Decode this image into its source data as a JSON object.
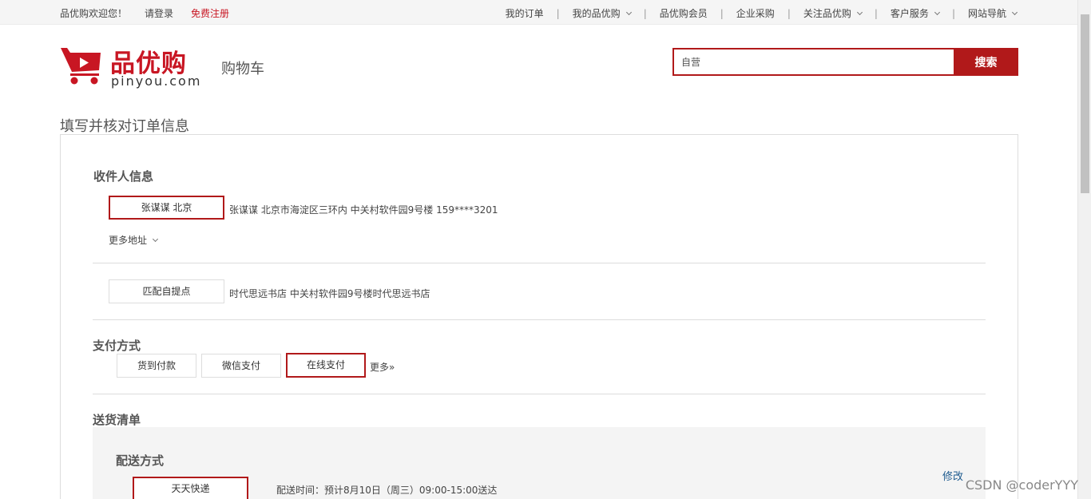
{
  "topbar": {
    "welcome": "品优购欢迎您！",
    "login": "请登录",
    "register": "免费注册",
    "nav": [
      {
        "label": "我的订单",
        "dropdown": false
      },
      {
        "label": "我的品优购",
        "dropdown": true
      },
      {
        "label": "品优购会员",
        "dropdown": false
      },
      {
        "label": "企业采购",
        "dropdown": false
      },
      {
        "label": "关注品优购",
        "dropdown": true
      },
      {
        "label": "客户服务",
        "dropdown": true
      },
      {
        "label": "网站导航",
        "dropdown": true
      }
    ]
  },
  "header": {
    "logo_cn": "品优购",
    "logo_en": "pinyou.com",
    "subtitle": "购物车",
    "search_value": "自营",
    "search_button": "搜索"
  },
  "page_title": "填写并核对订单信息",
  "receiver": {
    "title": "收件人信息",
    "selected": "张谋谋 北京",
    "detail": "张谋谋 北京市海淀区三环内 中关村软件园9号楼 159****3201",
    "more": "更多地址"
  },
  "pickup": {
    "button": "匹配自提点",
    "detail": "时代思远书店 中关村软件园9号楼时代思远书店"
  },
  "payment": {
    "title": "支付方式",
    "options": [
      "货到付款",
      "微信支付",
      "在线支付"
    ],
    "more": "更多»"
  },
  "shipping": {
    "title": "送货清单",
    "method_title": "配送方式",
    "method": "天天快递",
    "time": "配送时间：预计8月10日（周三）09:00-15:00送达",
    "edit": "修改"
  },
  "watermark": "CSDN @coderYYY",
  "colors": {
    "brand": "#b1191a",
    "register": "#c81623",
    "link": "#1c5a8e"
  }
}
